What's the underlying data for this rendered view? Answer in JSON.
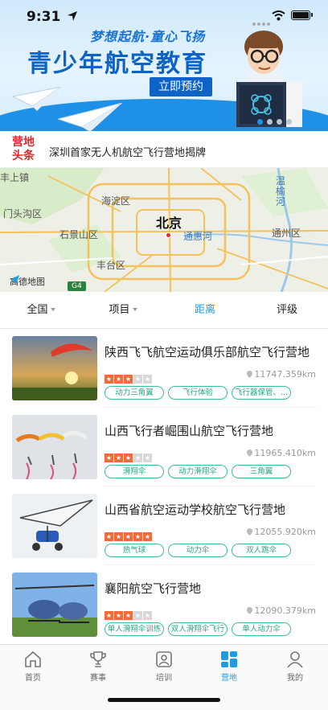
{
  "status_bar": {
    "time": "9:31"
  },
  "banner": {
    "slogan": "梦想起航·童心飞扬",
    "headline": "青少年航空教育",
    "cta": "立即预约",
    "pager_count": 4,
    "pager_active": 0
  },
  "news": {
    "tag_line1": "营地",
    "tag_line2": "头条",
    "text": "深圳首家无人机航空飞行营地揭牌"
  },
  "map": {
    "labels": [
      "丰上镇",
      "海淀区",
      "门头沟区",
      "石景山区",
      "丰台区",
      "通惠河",
      "通州区",
      "温榆河"
    ],
    "city": "北京",
    "provider": "高德地图",
    "highway": "G4"
  },
  "filters": [
    {
      "label": "全国",
      "dropdown": true
    },
    {
      "label": "项目",
      "dropdown": true
    },
    {
      "label": "距离",
      "dropdown": false
    },
    {
      "label": "评级",
      "dropdown": false
    }
  ],
  "active_filter": "距离",
  "camps": [
    {
      "title": "陕西飞飞航空运动俱乐部航空飞行营地",
      "rating": 3,
      "distance": "11747.359km",
      "tags": [
        "动力三角翼",
        "飞行体验",
        "飞行器保管、..."
      ]
    },
    {
      "title": "山西飞行者崛围山航空飞行营地",
      "rating": 3,
      "distance": "11965.410km",
      "tags": [
        "滑翔伞",
        "动力滑翔伞",
        "三角翼"
      ]
    },
    {
      "title": "山西省航空运动学校航空飞行营地",
      "rating": 5,
      "distance": "12055.920km",
      "tags": [
        "热气球",
        "动力伞",
        "双人跳伞"
      ]
    },
    {
      "title": "襄阳航空飞行营地",
      "rating": 3,
      "distance": "12090.379km",
      "tags": [
        "单人滑翔伞训练",
        "双人滑翔伞飞行",
        "单人动力伞"
      ]
    }
  ],
  "tabbar": [
    {
      "label": "首页",
      "icon": "home-icon"
    },
    {
      "label": "赛事",
      "icon": "trophy-icon"
    },
    {
      "label": "培训",
      "icon": "training-icon"
    },
    {
      "label": "营地",
      "icon": "camp-grid-icon"
    },
    {
      "label": "我的",
      "icon": "profile-icon"
    }
  ],
  "active_tab": "营地",
  "colors": {
    "accent": "#1f9be0",
    "brand_blue": "#0f63c6",
    "tag_green": "#2aa585",
    "star_on": "#f06a3a",
    "news_red": "#d42b2b"
  }
}
